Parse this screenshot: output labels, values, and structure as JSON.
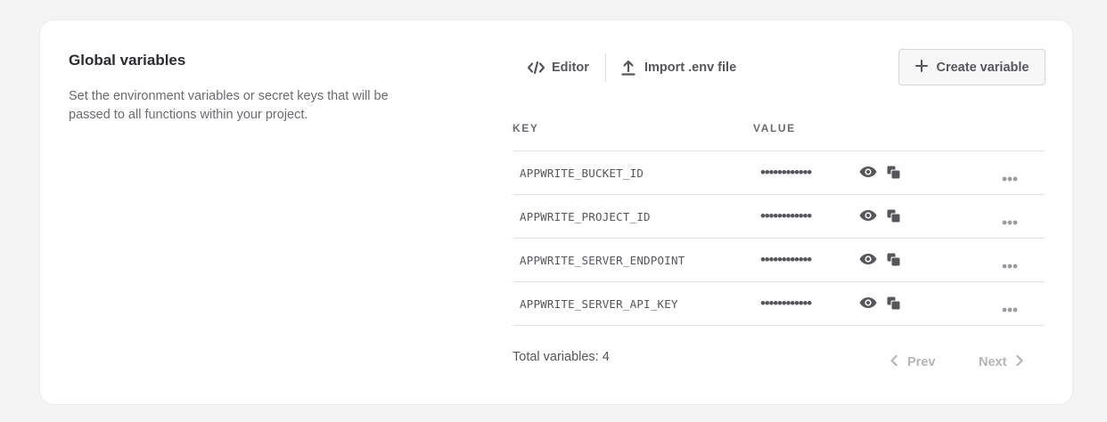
{
  "section": {
    "title": "Global variables",
    "description": "Set the environment variables or secret keys that will be passed to all functions within your project."
  },
  "toolbar": {
    "editor_label": "Editor",
    "import_label": "Import .env file",
    "create_label": "Create variable"
  },
  "table": {
    "headers": {
      "key": "KEY",
      "value": "VALUE"
    },
    "rows": [
      {
        "key": "APPWRITE_BUCKET_ID",
        "value": "••••••••••••"
      },
      {
        "key": "APPWRITE_PROJECT_ID",
        "value": "••••••••••••"
      },
      {
        "key": "APPWRITE_SERVER_ENDPOINT",
        "value": "••••••••••••"
      },
      {
        "key": "APPWRITE_SERVER_API_KEY",
        "value": "••••••••••••"
      }
    ]
  },
  "footer": {
    "total_label": "Total variables: 4",
    "prev_label": "Prev",
    "next_label": "Next"
  },
  "icons": {
    "editor": "code-icon",
    "import": "upload-icon",
    "create": "plus-icon",
    "reveal": "eye-icon",
    "copy": "copy-icon",
    "more": "more-horizontal-icon",
    "prev": "chevron-left-icon",
    "next": "chevron-right-icon"
  },
  "colors": {
    "text_primary": "#2d2d31",
    "text_secondary": "#56565c",
    "text_disabled": "#b4b4ba",
    "background": "#f4f4f4",
    "card": "#ffffff"
  }
}
